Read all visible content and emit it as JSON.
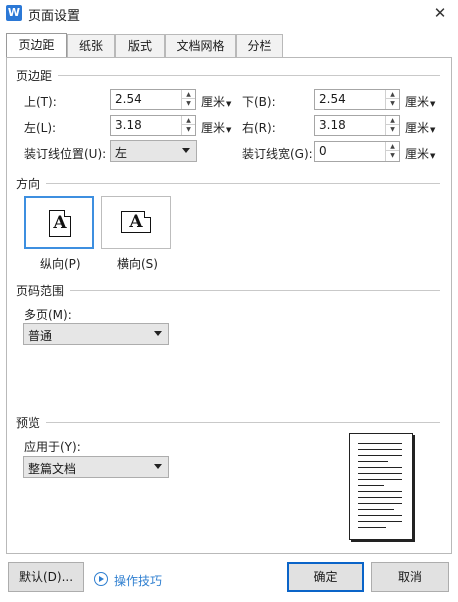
{
  "window": {
    "title": "页面设置",
    "app_icon_letter": "W"
  },
  "tabs": [
    "页边距",
    "纸张",
    "版式",
    "文档网格",
    "分栏"
  ],
  "margins": {
    "section_label": "页边距",
    "top": {
      "label": "上(T):",
      "value": "2.54",
      "unit": "厘米"
    },
    "bottom": {
      "label": "下(B):",
      "value": "2.54",
      "unit": "厘米"
    },
    "left": {
      "label": "左(L):",
      "value": "3.18",
      "unit": "厘米"
    },
    "right": {
      "label": "右(R):",
      "value": "3.18",
      "unit": "厘米"
    },
    "gutter_pos": {
      "label": "装订线位置(U):",
      "value": "左"
    },
    "gutter": {
      "label": "装订线宽(G):",
      "value": "0",
      "unit": "厘米"
    }
  },
  "orientation": {
    "section_label": "方向",
    "glyph": "A",
    "portrait": "纵向(P)",
    "landscape": "横向(S)",
    "selected": "portrait"
  },
  "pages": {
    "section_label": "页码范围",
    "multiple_label": "多页(M):",
    "multiple_value": "普通"
  },
  "preview": {
    "section_label": "预览",
    "apply_label": "应用于(Y):",
    "apply_value": "整篇文档"
  },
  "footer": {
    "default_button": "默认(D)...",
    "tips_link": "操作技巧",
    "ok_button": "确定",
    "cancel_button": "取消"
  }
}
